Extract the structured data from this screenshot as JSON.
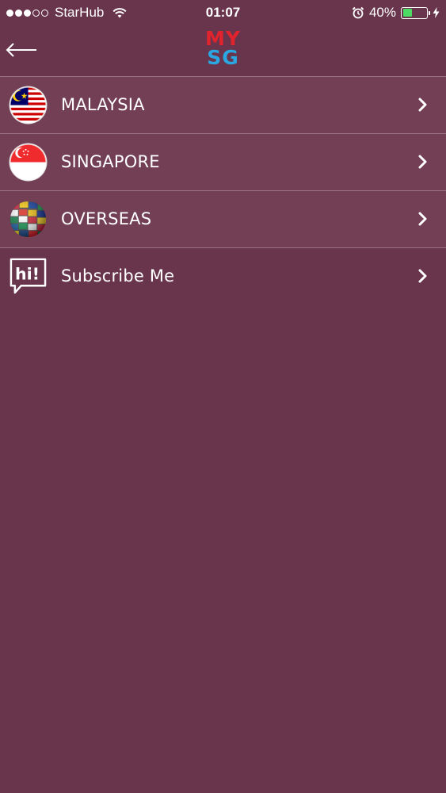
{
  "status_bar": {
    "carrier": "StarHub",
    "time": "01:07",
    "battery_percent": "40%",
    "battery_level": 0.4,
    "signal_icon": "signal-dots-icon",
    "wifi_icon": "wifi-icon",
    "alarm_icon": "alarm-icon",
    "charging_icon": "charging-bolt-icon"
  },
  "nav": {
    "back_icon": "back-arrow-icon",
    "logo_top": "MY",
    "logo_bottom": "SG"
  },
  "menu": {
    "items": [
      {
        "label": "MALAYSIA",
        "icon": "malaysia-flag-icon"
      },
      {
        "label": "SINGAPORE",
        "icon": "singapore-flag-icon"
      },
      {
        "label": "OVERSEAS",
        "icon": "world-flags-globe-icon"
      },
      {
        "label": "Subscribe Me",
        "icon": "hi-speech-bubble-icon"
      }
    ],
    "chevron_icon": "chevron-right-icon"
  },
  "colors": {
    "background": "#69354c",
    "highlight_row": "#723f55",
    "logo_my": "#e0232d",
    "logo_sg": "#2aa7e0",
    "battery_fill": "#4cd964"
  }
}
